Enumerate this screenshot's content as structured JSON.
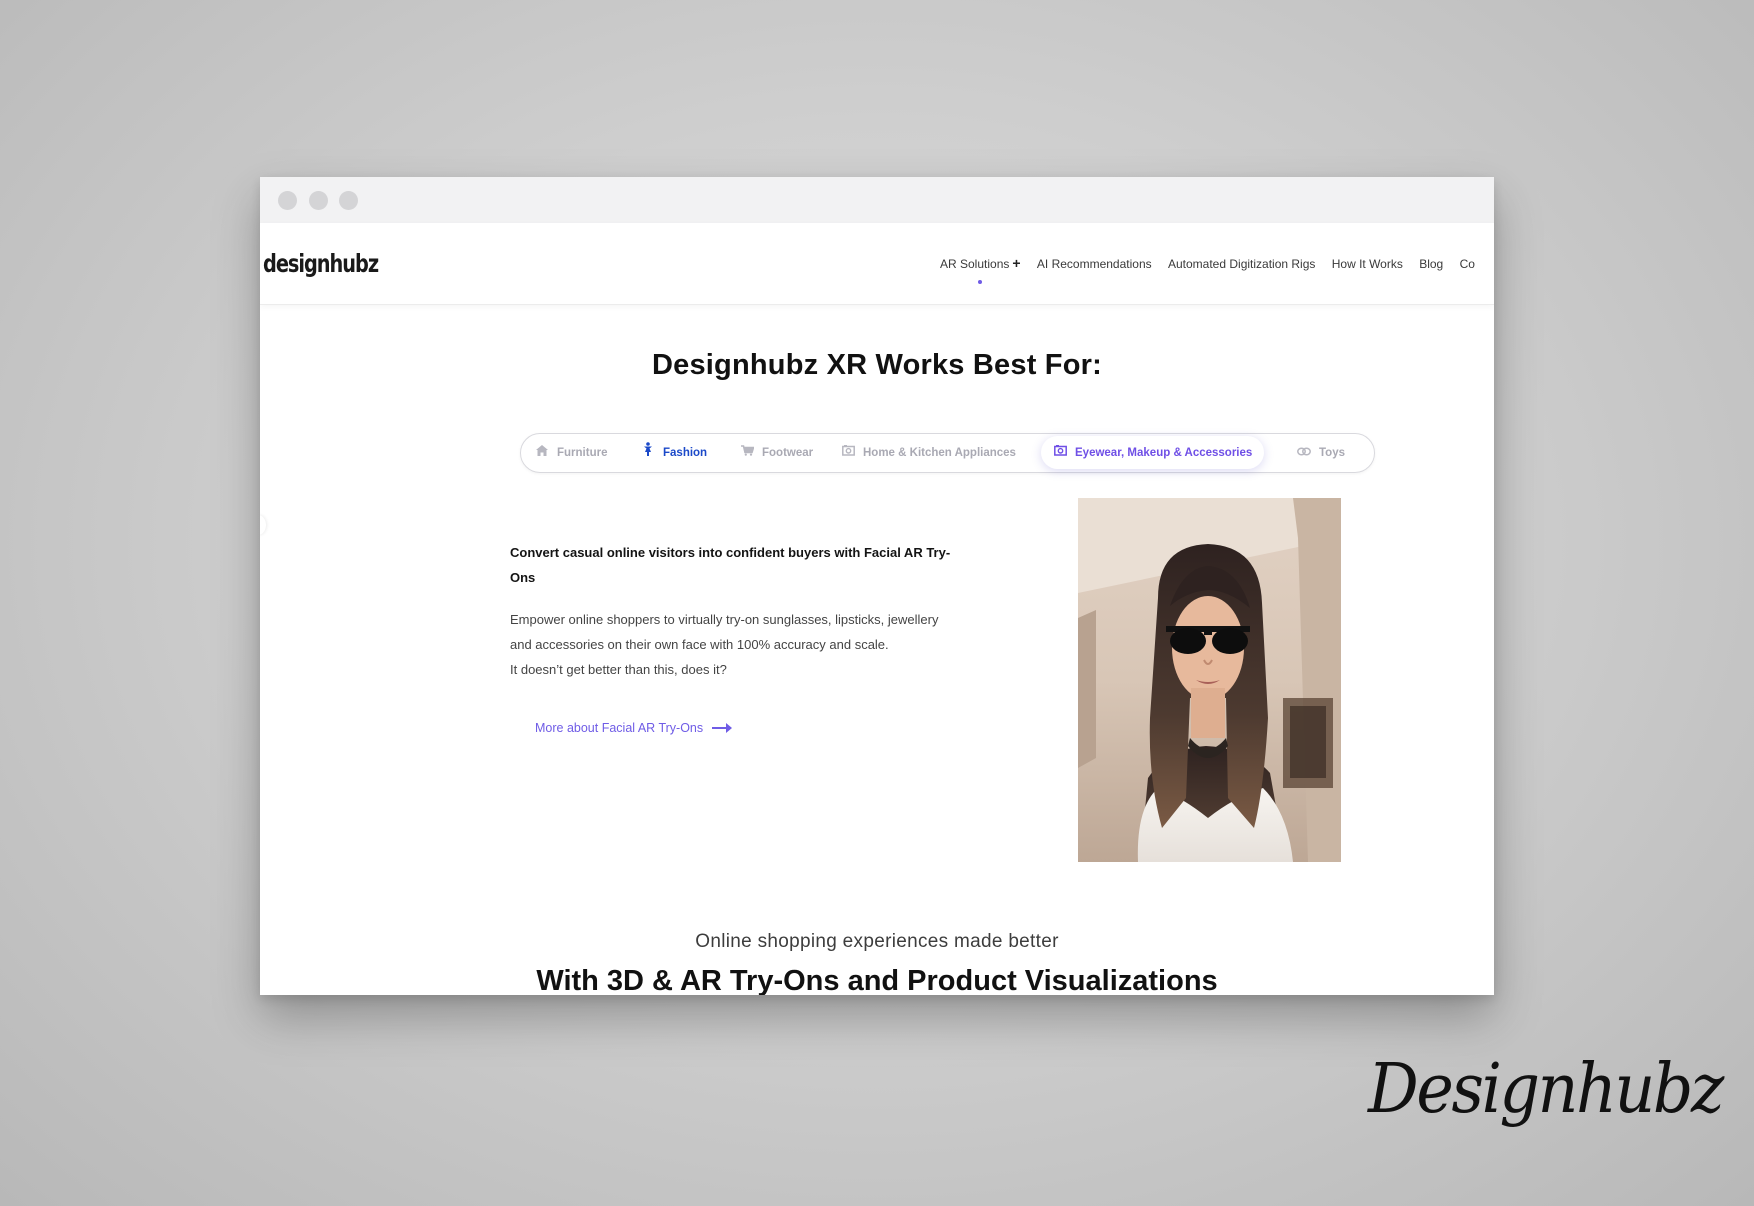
{
  "site": {
    "logo_text": "designhubz",
    "nav": [
      {
        "label": "AR Solutions",
        "has_plus": true
      },
      {
        "label": "AI Recommendations"
      },
      {
        "label": "Automated Digitization Rigs"
      },
      {
        "label": "How It Works"
      },
      {
        "label": "Blog"
      },
      {
        "label": "Co"
      }
    ]
  },
  "main": {
    "section_title": "Designhubz XR Works Best For:",
    "tabs": [
      {
        "label": "Furniture",
        "icon": "house-icon",
        "active": false
      },
      {
        "label": "Fashion",
        "icon": "person-icon",
        "active": false,
        "highlight": true
      },
      {
        "label": "Footwear",
        "icon": "cart-icon",
        "active": false
      },
      {
        "label": "Home & Kitchen Appliances",
        "icon": "camera-icon",
        "active": false
      },
      {
        "label": "Eyewear, Makeup & Accessories",
        "icon": "camera-icon",
        "active": true
      },
      {
        "label": "Toys",
        "icon": "link-icon",
        "active": false
      }
    ],
    "content": {
      "heading": "Convert casual online visitors into confident buyers with Facial AR Try-Ons",
      "body_1": "Empower online shoppers to virtually try-on sunglasses, lipsticks, jewellery and accessories on their own face with 100% accuracy and scale.",
      "body_2": "It doesn’t get better than this, does it?",
      "link_label": "More about Facial AR Try-Ons"
    },
    "subtitle": "Online shopping experiences made better",
    "big_heading": "With 3D & AR Try-Ons and Product Visualizations"
  },
  "brand_signature": "Designhubz",
  "colors": {
    "accent": "#6f5ce6",
    "fashion_blue": "#1b49c9",
    "inactive_tab": "#a9a9b3"
  }
}
